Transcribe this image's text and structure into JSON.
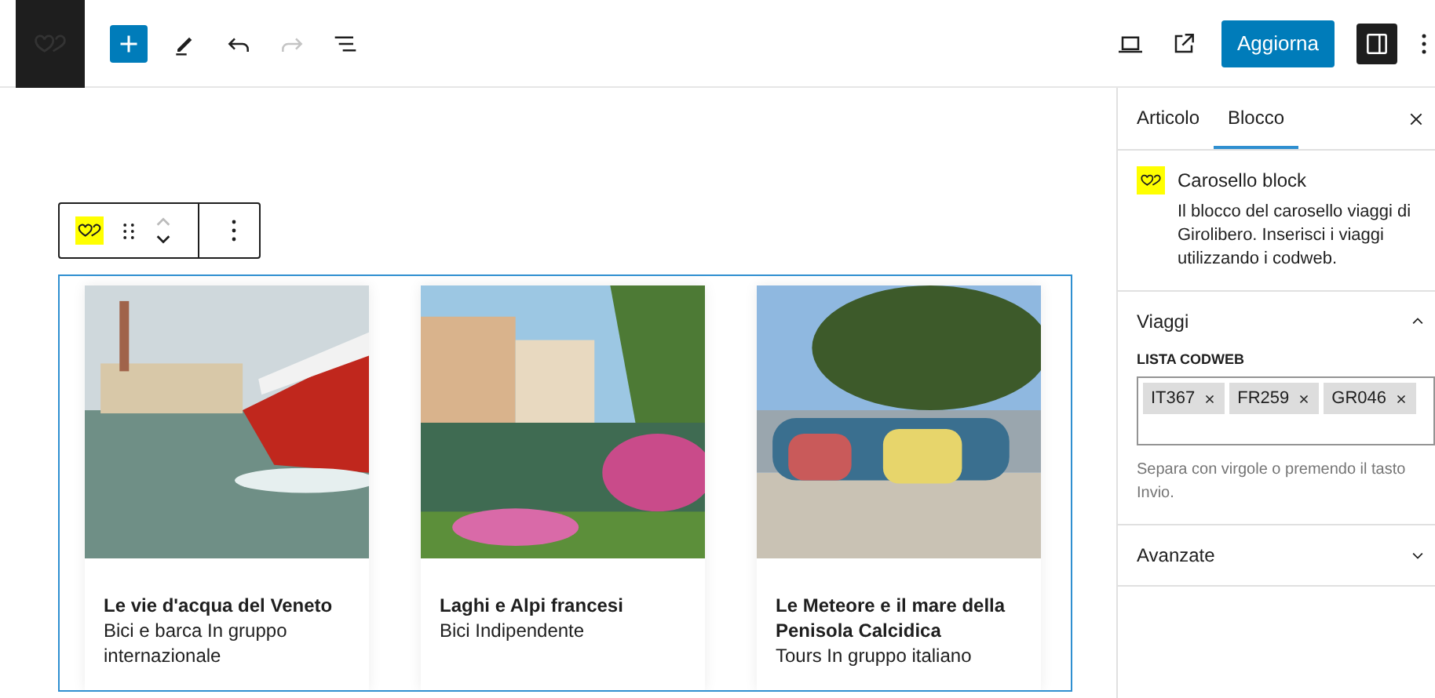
{
  "toolbar": {
    "redo_disabled": true,
    "update_button": "Aggiorna",
    "sidebar_toggle_on": true
  },
  "carousel": {
    "cards": [
      {
        "title": "Le vie d'acqua del Veneto",
        "subtitle": "Bici e barca In gruppo internazionale"
      },
      {
        "title": "Laghi e Alpi francesi",
        "subtitle": "Bici Indipendente"
      },
      {
        "title": "Le Meteore e il mare della Penisola Calcidica",
        "subtitle": "Tours In gruppo italiano"
      }
    ]
  },
  "sidebar": {
    "tabs": [
      {
        "label": "Articolo",
        "selected": false
      },
      {
        "label": "Blocco",
        "selected": true
      }
    ],
    "block": {
      "name": "Carosello block",
      "description": "Il blocco del carosello viaggi di Girolibero. Inserisci i viaggi utilizzando i codweb."
    },
    "panels": [
      {
        "title": "Viaggi",
        "expanded": true,
        "field_label": "LISTA CODWEB",
        "tags": [
          "IT367",
          "FR259",
          "GR046"
        ],
        "help": "Separa con virgole o premendo il tasto Invio."
      },
      {
        "title": "Avanzate",
        "expanded": false
      }
    ]
  }
}
